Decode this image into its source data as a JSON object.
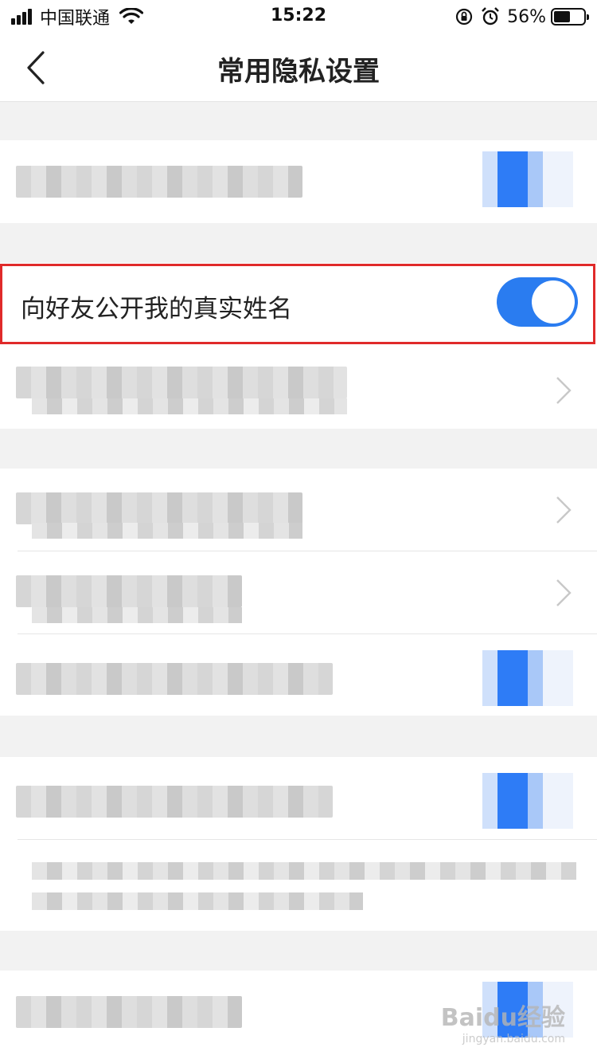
{
  "status_bar": {
    "carrier": "中国联通",
    "time": "15:22",
    "battery_percent": "56%",
    "battery_level": 0.56
  },
  "nav": {
    "title": "常用隐私设置",
    "back_icon": "chevron-left-icon"
  },
  "settings": {
    "real_name_toggle": {
      "label": "向好友公开我的真实姓名",
      "enabled": true
    }
  },
  "colors": {
    "accent": "#2a7cf0",
    "highlight": "#e02a2a",
    "background": "#f2f2f2"
  },
  "watermark": {
    "main": "Baidu经验",
    "sub": "jingyan.baidu.com"
  }
}
